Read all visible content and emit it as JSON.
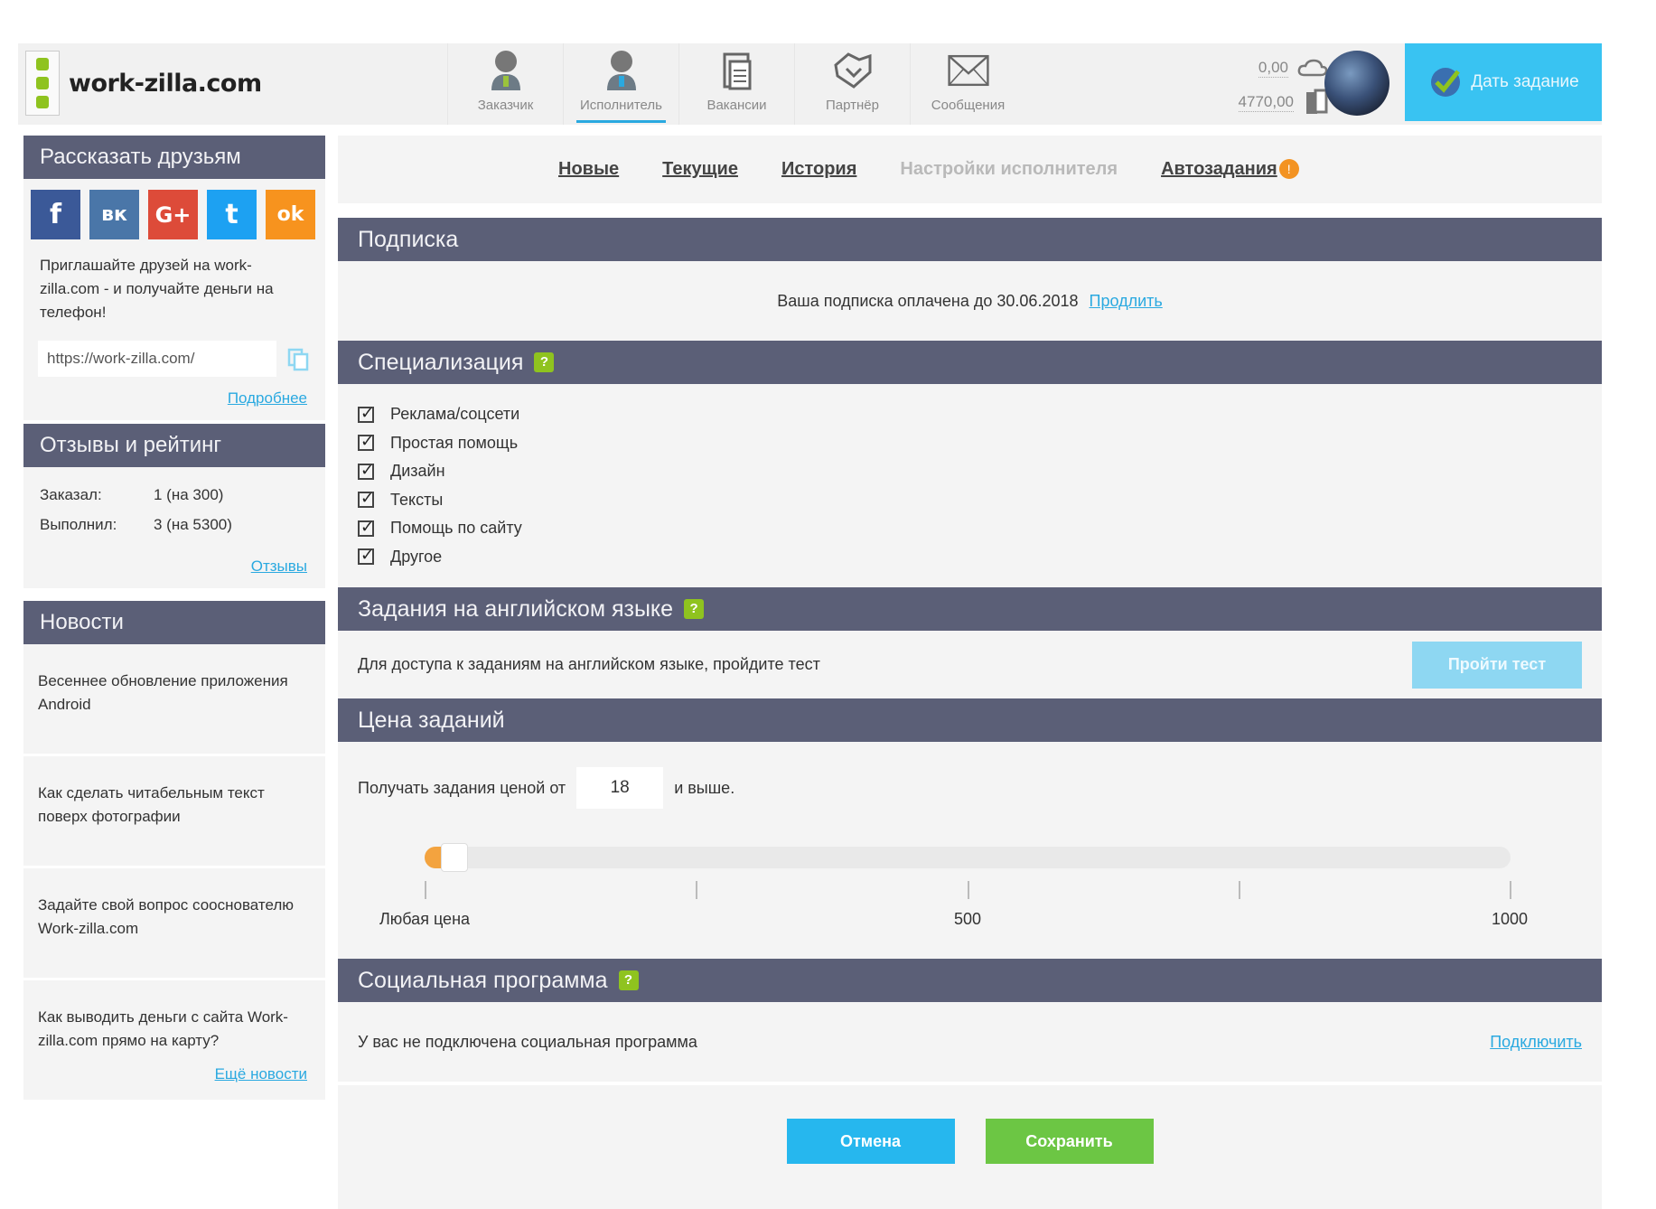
{
  "header": {
    "logo_text": "work-zilla.com",
    "nav": [
      {
        "label": "Заказчик",
        "icon": "client-icon"
      },
      {
        "label": "Исполнитель",
        "icon": "executor-icon",
        "active": true
      },
      {
        "label": "Вакансии",
        "icon": "vacancies-icon"
      },
      {
        "label": "Партнёр",
        "icon": "partner-icon"
      },
      {
        "label": "Сообщения",
        "icon": "envelope-icon"
      }
    ],
    "balance_main": "0,00",
    "balance_secondary": "4770,00",
    "give_task_label": "Дать задание"
  },
  "sidebar": {
    "share_title": "Рассказать друзьям",
    "social": [
      {
        "name": "facebook",
        "glyph": "f",
        "color": "#3b5998"
      },
      {
        "name": "vk",
        "glyph": "вк",
        "color": "#4a76a8"
      },
      {
        "name": "google-plus",
        "glyph": "G+",
        "color": "#dd4b39"
      },
      {
        "name": "twitter",
        "glyph": "t",
        "color": "#1da1f2"
      },
      {
        "name": "odnoklassniki",
        "glyph": "ok",
        "color": "#f7931e"
      }
    ],
    "invite_text": "Приглашайте друзей на work-zilla.com - и получайте деньги на телефон!",
    "invite_url": "https://work-zilla.com/",
    "more_link": "Подробнее",
    "reviews_title": "Отзывы и рейтинг",
    "ordered_label": "Заказал:",
    "ordered_value": "1 (на 300)",
    "done_label": "Выполнил:",
    "done_value": "3 (на 5300)",
    "reviews_link": "Отзывы",
    "news_title": "Новости",
    "news": [
      "Весеннее обновление приложения Android",
      "Как сделать читабельным текст поверх фотографии",
      "Задайте свой вопрос сооснователю Work-zilla.com",
      "Как выводить деньги с сайта Work-zilla.com прямо на карту?"
    ],
    "more_news_link": "Ещё новости"
  },
  "tabs": {
    "new": "Новые",
    "current": "Текущие",
    "history": "История",
    "settings": "Настройки исполнителя",
    "auto": "Автозадания",
    "auto_badge": "!"
  },
  "subscription": {
    "title": "Подписка",
    "text": "Ваша подписка оплачена до 30.06.2018",
    "extend_link": "Продлить"
  },
  "specialization": {
    "title": "Специализация",
    "help": "?",
    "items": [
      "Реклама/соцсети",
      "Простая помощь",
      "Дизайн",
      "Тексты",
      "Помощь по сайту",
      "Другое"
    ]
  },
  "english": {
    "title": "Задания на английском языке",
    "help": "?",
    "text": "Для доступа к заданиям на английском языке, пройдите тест",
    "button": "Пройти тест"
  },
  "price": {
    "title": "Цена заданий",
    "label_before": "Получать задания ценой от",
    "value": "18",
    "label_after": "и выше.",
    "slider_fraction": 0.018,
    "tick_labels": {
      "min": "Любая цена",
      "mid": "500",
      "max": "1000"
    }
  },
  "social_program": {
    "title": "Социальная программа",
    "help": "?",
    "text": "У вас не подключена социальная программа",
    "connect_link": "Подключить"
  },
  "actions": {
    "cancel": "Отмена",
    "save": "Сохранить"
  },
  "colors": {
    "section_header": "#5b5f77",
    "accent_blue": "#39c3f2",
    "save_green": "#6cc644",
    "help_green": "#8fc31f",
    "slider_orange": "#f3a33f"
  }
}
